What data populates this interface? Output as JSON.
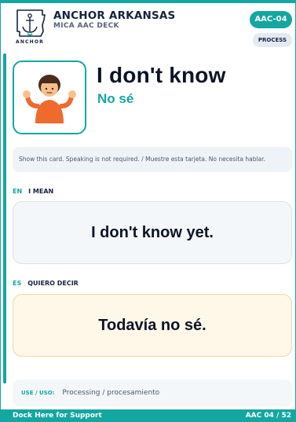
{
  "header": {
    "brand": "ANCHOR ARKANSAS",
    "deck": "MICA AAC DECK",
    "logo_text": "ANCHOR",
    "card_code": "AAC-04",
    "category": "PROCESS"
  },
  "card": {
    "symbol_icon": "shrugging-person-icon",
    "title": "I don't know",
    "subtitle": "No sé",
    "note": "Show this card. Speaking is not required. / Muestre esta tarjeta. No necesita hablar."
  },
  "english": {
    "code": "EN",
    "label": "I MEAN",
    "phrase": "I don't know yet."
  },
  "spanish": {
    "code": "ES",
    "label": "QUIERO DECIR",
    "phrase": "Todavía no sé."
  },
  "use": {
    "label": "USE / USO:",
    "value": "Processing / procesamiento"
  },
  "footer": {
    "left": "Dock Here for Support",
    "right": "AAC 04 / 52"
  },
  "colors": {
    "accent": "#14a6a0",
    "navy": "#13233f",
    "spanish_card_bg": "#fff7e7",
    "english_card_bg": "#f4f7fa"
  }
}
